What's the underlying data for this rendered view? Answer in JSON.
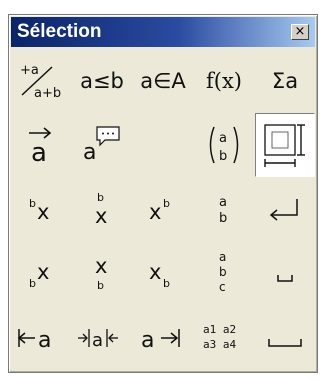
{
  "window": {
    "title": "Sélection",
    "close_label": "×"
  },
  "symbols": [
    [
      "a≤b",
      "a∈A",
      "f(x)",
      "Σa"
    ],
    [
      "a⃗",
      "a",
      "(a/b)",
      ""
    ],
    [
      "ᵇx",
      "b x",
      "xᵇ",
      "a b",
      "↵"
    ],
    [
      "ᵦx",
      "x b",
      "xᵦ",
      "a b c",
      "␣"
    ],
    [
      "⇤a",
      "⇥a⇤",
      "a→",
      "a1 a2 a3 a4",
      "⎵"
    ]
  ],
  "cells": {
    "r1": {
      "c2": "a≤b",
      "c3": "a∈A",
      "c4": "f(x)",
      "c5": "Σa",
      "c1_top": "+a",
      "c1_bottom": "a+b"
    },
    "r2": {
      "c1": "a",
      "c2": "a",
      "c4_top": "a",
      "c4_bottom": "b"
    },
    "r3": {
      "c1_sup": "b",
      "c1": "x",
      "c2_top": "b",
      "c2": "x",
      "c3": "x",
      "c3_sup": "b",
      "c4_top": "a",
      "c4_bottom": "b",
      "c5": "⟵"
    },
    "r4": {
      "c1_sub": "b",
      "c1": "x",
      "c2": "x",
      "c2_bottom": "b",
      "c3": "x",
      "c3_sub": "b",
      "c4_1": "a",
      "c4_2": "b",
      "c4_3": "c",
      "c5": "⌴"
    },
    "r5": {
      "c1": "⊢a",
      "c2": "→|a|←",
      "c3": "a→",
      "c4_top": "a1 a2",
      "c4_bottom": "a3 a4",
      "c5": "⎵"
    }
  }
}
